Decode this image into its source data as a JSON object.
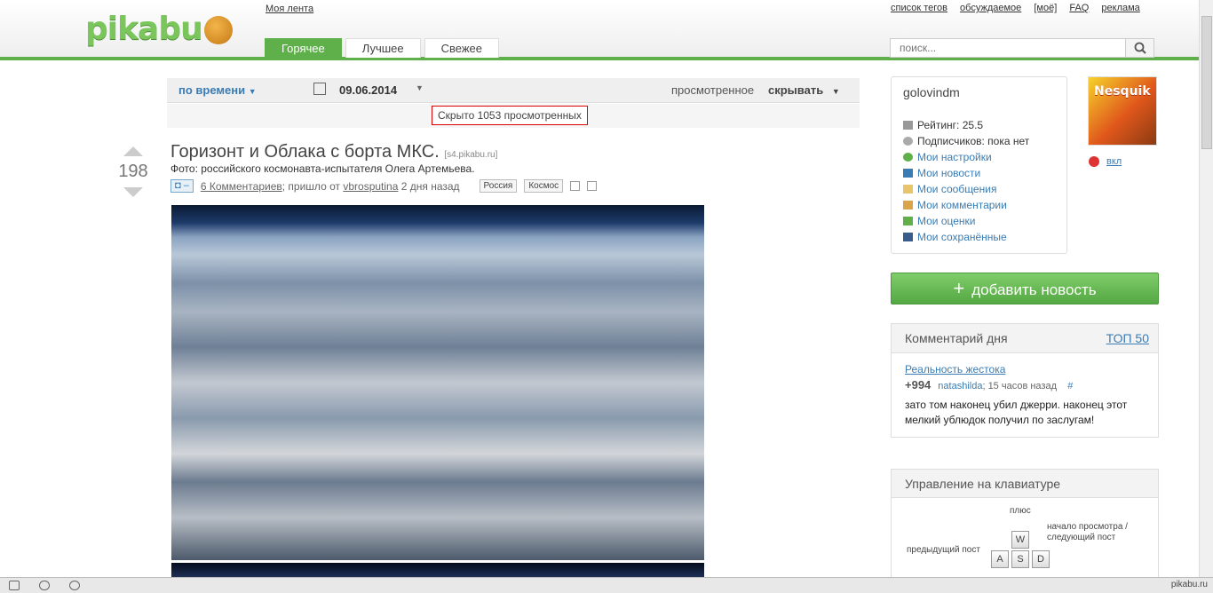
{
  "header": {
    "logo": "pikabu",
    "myfeed": "Моя лента",
    "links": [
      "список тегов",
      "обсуждаемое",
      "[моё]",
      "FAQ",
      "реклама"
    ],
    "tabs": [
      "Горячее",
      "Лучшее",
      "Свежее"
    ],
    "active_tab": "Горячее",
    "search_placeholder": "поиск..."
  },
  "filters": {
    "sort": "по времени",
    "date": "09.06.2014",
    "viewed": "просмотренное",
    "hide": "скрывать",
    "hidden_count_text": "Скрыто 1053 просмотренных"
  },
  "post": {
    "rating": "198",
    "title": "Горизонт и Облака с борта МКС.",
    "source": "[s4.pikabu.ru]",
    "description": "Фото: российского космонавта-испытателя Олега Артемьева.",
    "badge": "–",
    "comments": "6 Комментариев",
    "posted_by": "; пришло от",
    "author": "vbrosputina",
    "time": "2 дня назад",
    "tags": [
      "Россия",
      "Космос"
    ]
  },
  "user": {
    "name": "golovindm",
    "rating": "Рейтинг: 25.5",
    "subscribers": "Подписчиков: пока нет",
    "links": [
      "Мои настройки",
      "Мои новости",
      "Мои сообщения",
      "Мои комментарии",
      "Мои оценки",
      "Мои сохранённые"
    ],
    "avatar_text": "Nesquik",
    "vkl": "вкл"
  },
  "add_news": "добавить новость",
  "comment_of_day": {
    "title": "Комментарий дня",
    "top": "ТОП 50",
    "post_link": "Реальность жестока",
    "score": "+994",
    "author": "natashilda",
    "time": "; 15 часов назад",
    "hash": "#",
    "text": "зато том наконец убил джерри. наконец этот мелкий ублюдок получил по заслугам!"
  },
  "keyboard": {
    "title": "Управление на клавиатуре",
    "plus": "плюс",
    "next": "начало просмотра / следующий пост",
    "prev": "предыдущий пост",
    "keys": [
      "W",
      "A",
      "S",
      "D"
    ]
  },
  "statusbar": {
    "domain": "pikabu.ru"
  },
  "colors": {
    "accent": "#5fb04b",
    "link": "#3a7cb3",
    "alert": "#dd0000"
  }
}
